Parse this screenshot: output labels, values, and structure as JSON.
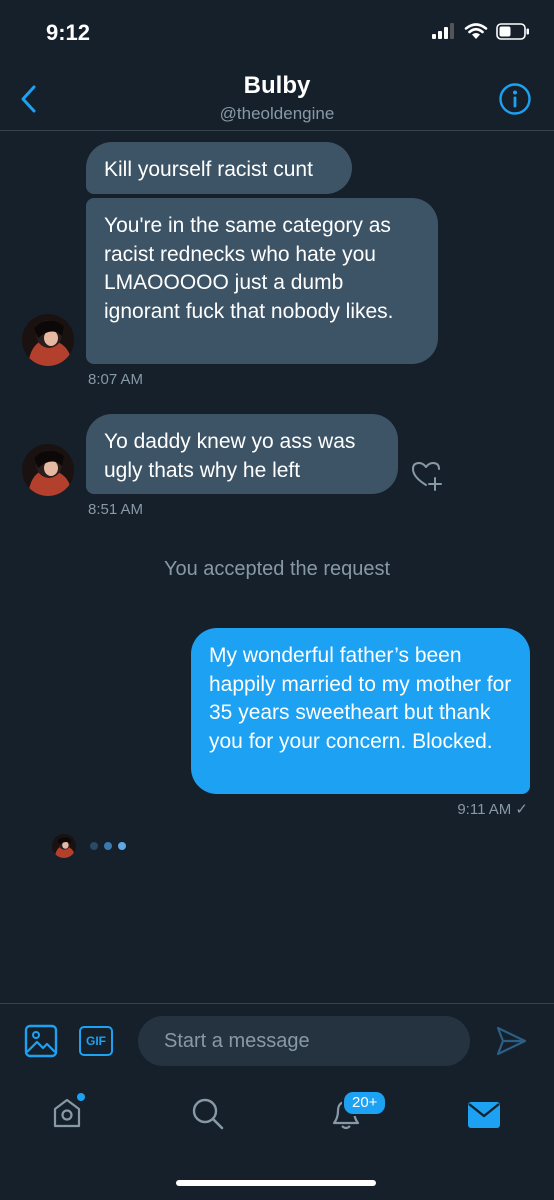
{
  "status_bar": {
    "time": "9:12"
  },
  "header": {
    "name": "Bulby",
    "handle": "@theoldengine"
  },
  "messages": [
    {
      "text": "Kill yourself racist cunt"
    },
    {
      "text": "You're in the same category as racist rednecks who hate you LMAOOOOO just a dumb ignorant fuck that nobody likes.",
      "time": "8:07 AM"
    },
    {
      "text": "Yo daddy knew yo ass was ugly thats why he left",
      "time": "8:51 AM"
    }
  ],
  "system_message": "You accepted the request",
  "outgoing": {
    "text": "My wonderful father’s been happily married to my mother for 35 years sweetheart but thank you for your concern. Blocked.",
    "time": "9:11 AM ✓"
  },
  "composer": {
    "placeholder": "Start a message",
    "gif_label": "GIF"
  },
  "tabbar": {
    "notifications_badge": "20+"
  },
  "colors": {
    "background": "#15202b",
    "incoming_bubble": "#3d5466",
    "outgoing_bubble": "#1da1f2",
    "accent": "#1da1f2",
    "muted": "#8899a6"
  }
}
